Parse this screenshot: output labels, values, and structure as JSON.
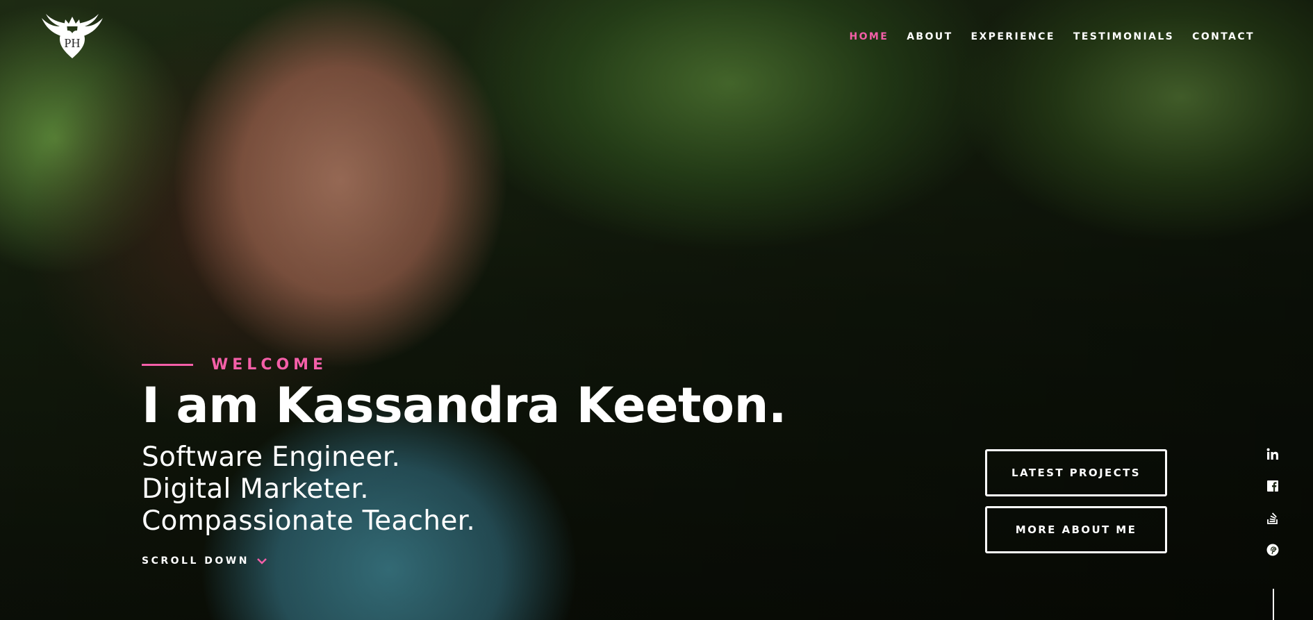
{
  "header": {
    "logo_monogram": "PH",
    "nav": [
      {
        "label": "HOME",
        "active": true
      },
      {
        "label": "ABOUT",
        "active": false
      },
      {
        "label": "EXPERIENCE",
        "active": false
      },
      {
        "label": "TESTIMONIALS",
        "active": false
      },
      {
        "label": "CONTACT",
        "active": false
      }
    ]
  },
  "intro": {
    "welcome": "WELCOME",
    "headline": "I am Kassandra Keeton.",
    "roles": [
      "Software Engineer.",
      "Digital Marketer.",
      "Compassionate Teacher."
    ],
    "scroll_label": "SCROLL DOWN"
  },
  "buttons": {
    "latest_projects": "LATEST PROJECTS",
    "more_about": "MORE ABOUT ME"
  },
  "social": [
    "linkedin-icon",
    "facebook-icon",
    "stackoverflow-icon",
    "pinterest-icon"
  ],
  "colors": {
    "accent": "#f45fa8",
    "text": "#ffffff"
  }
}
